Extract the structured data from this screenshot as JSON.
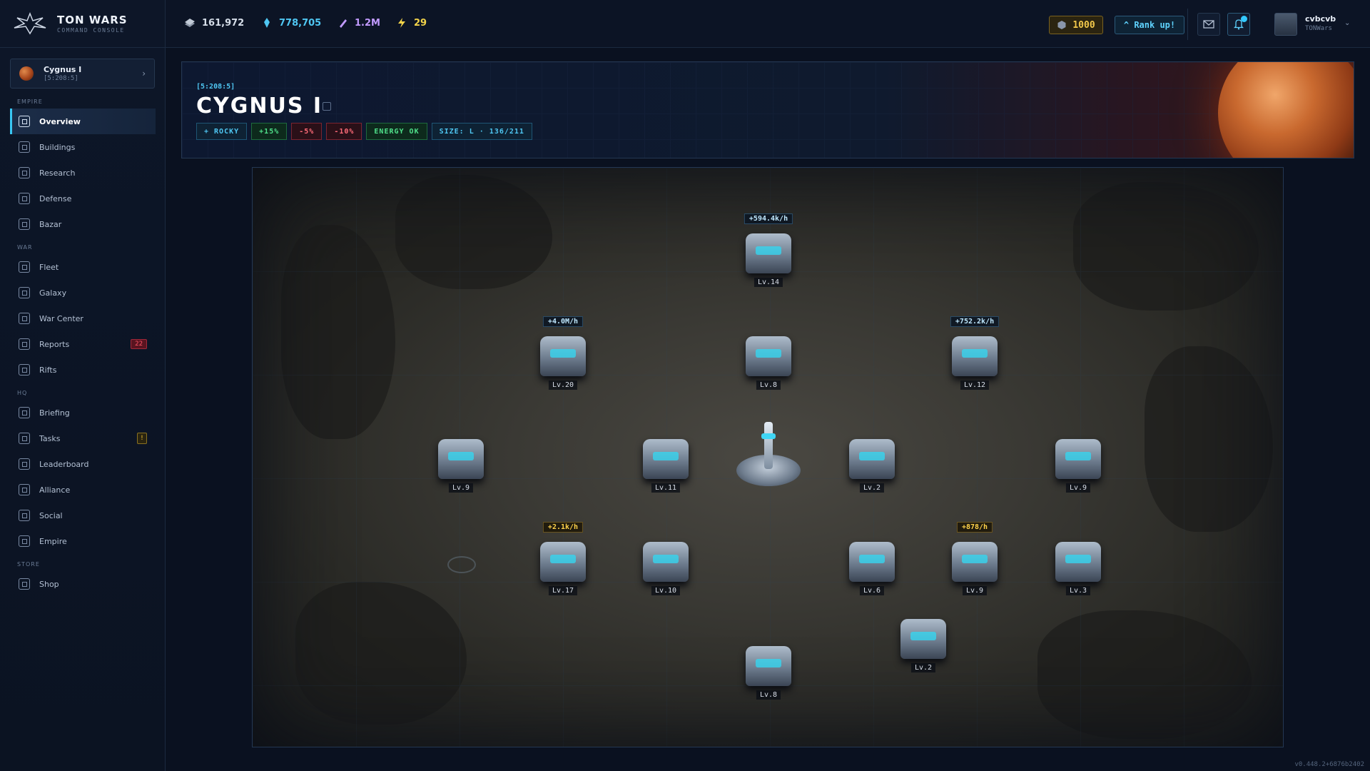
{
  "app": {
    "title": "TON WARS",
    "subtitle": "COMMAND CONSOLE",
    "version": "v0.448.2+6876b2402"
  },
  "planet_card": {
    "name": "Cygnus I",
    "coord": "[5:208:5]"
  },
  "nav": {
    "sections": [
      {
        "label": "EMPIRE",
        "items": [
          {
            "label": "Overview",
            "active": true
          },
          {
            "label": "Buildings"
          },
          {
            "label": "Research"
          },
          {
            "label": "Defense"
          },
          {
            "label": "Bazar"
          }
        ]
      },
      {
        "label": "WAR",
        "items": [
          {
            "label": "Fleet"
          },
          {
            "label": "Galaxy"
          },
          {
            "label": "War Center"
          },
          {
            "label": "Reports",
            "badge": "22"
          },
          {
            "label": "Rifts"
          }
        ]
      },
      {
        "label": "HQ",
        "items": [
          {
            "label": "Briefing"
          },
          {
            "label": "Tasks",
            "badge": "!"
          },
          {
            "label": "Leaderboard"
          },
          {
            "label": "Alliance"
          },
          {
            "label": "Social"
          },
          {
            "label": "Empire"
          }
        ]
      },
      {
        "label": "STORE",
        "items": [
          {
            "label": "Shop"
          }
        ]
      }
    ]
  },
  "resources": {
    "metal": "161,972",
    "crystal": "778,705",
    "deuterium": "1.2M",
    "energy": "29"
  },
  "topbar": {
    "gold": "1000",
    "rank_label": "^ Rank up!",
    "user_name": "cvbcvb",
    "user_sub": "TONWars"
  },
  "colors": {
    "accent": "#38c6f2",
    "metal": "#b9c3d1",
    "crystal": "#4fc7f3",
    "deuterium": "#c29bff",
    "energy": "#f2d34a",
    "gold": "#f2c84b"
  },
  "planet": {
    "coord": "[5:208:5]",
    "name": "CYGNUS I",
    "tags": [
      "+ ROCKY",
      "+15%",
      "-5%",
      "-10%",
      "ENERGY OK",
      "SIZE: L · 136/211"
    ]
  },
  "map": {
    "buildings": [
      {
        "level": "Lv.14",
        "rate": "+594.4k/h"
      },
      {
        "level": "Lv.20",
        "rate": "+4.0M/h"
      },
      {
        "level": "Lv.8"
      },
      {
        "level": "Lv.12",
        "rate": "+752.2k/h"
      },
      {
        "level": "Lv.9"
      },
      {
        "level": "Lv.11"
      },
      {
        "level": "Lv.2"
      },
      {
        "level": "Lv.9"
      },
      {
        "level": "Lv.17",
        "rate": "+2.1k/h"
      },
      {
        "level": "Lv.10"
      },
      {
        "level": "Lv.6"
      },
      {
        "level": "Lv.9",
        "rate": "+878/h"
      },
      {
        "level": "Lv.3"
      },
      {
        "level": "Lv.2"
      },
      {
        "level": "Lv.8"
      }
    ]
  }
}
